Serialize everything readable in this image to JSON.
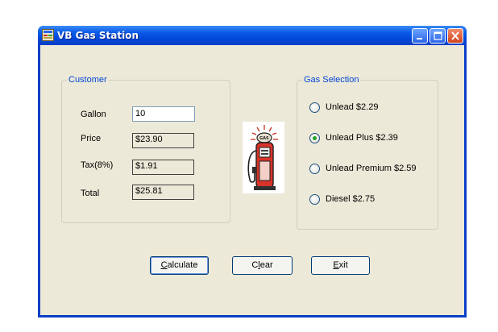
{
  "window": {
    "title": "VB Gas Station"
  },
  "customer": {
    "group_label": "Customer",
    "gallon_label": "Gallon",
    "gallon_value": "10",
    "price_label": "Price",
    "price_value": "$23.90",
    "tax_label": "Tax(8%)",
    "tax_value": "$1.91",
    "total_label": "Total",
    "total_value": "$25.81"
  },
  "gas_selection": {
    "group_label": "Gas Selection",
    "options": [
      {
        "label": "Unlead $2.29",
        "checked": false
      },
      {
        "label": "Unlead Plus $2.39",
        "checked": true
      },
      {
        "label": "Unlead Premium $2.59",
        "checked": false
      },
      {
        "label": "Diesel $2.75",
        "checked": false
      }
    ]
  },
  "buttons": {
    "calculate": {
      "accel": "C",
      "rest": "alculate"
    },
    "clear": {
      "pre": "C",
      "accel": "l",
      "rest": "ear"
    },
    "exit": {
      "accel": "E",
      "rest": "xit"
    }
  },
  "colors": {
    "title_bar": "#0a5ae8",
    "window_bg": "#ece9d8",
    "group_label": "#0046d5",
    "radio_dot": "#21a121",
    "close_button": "#d2441c"
  },
  "icons": {
    "app": "app-icon",
    "pump": "gas-pump-icon",
    "minimize": "minimize-icon",
    "maximize": "maximize-icon",
    "close": "close-icon"
  }
}
